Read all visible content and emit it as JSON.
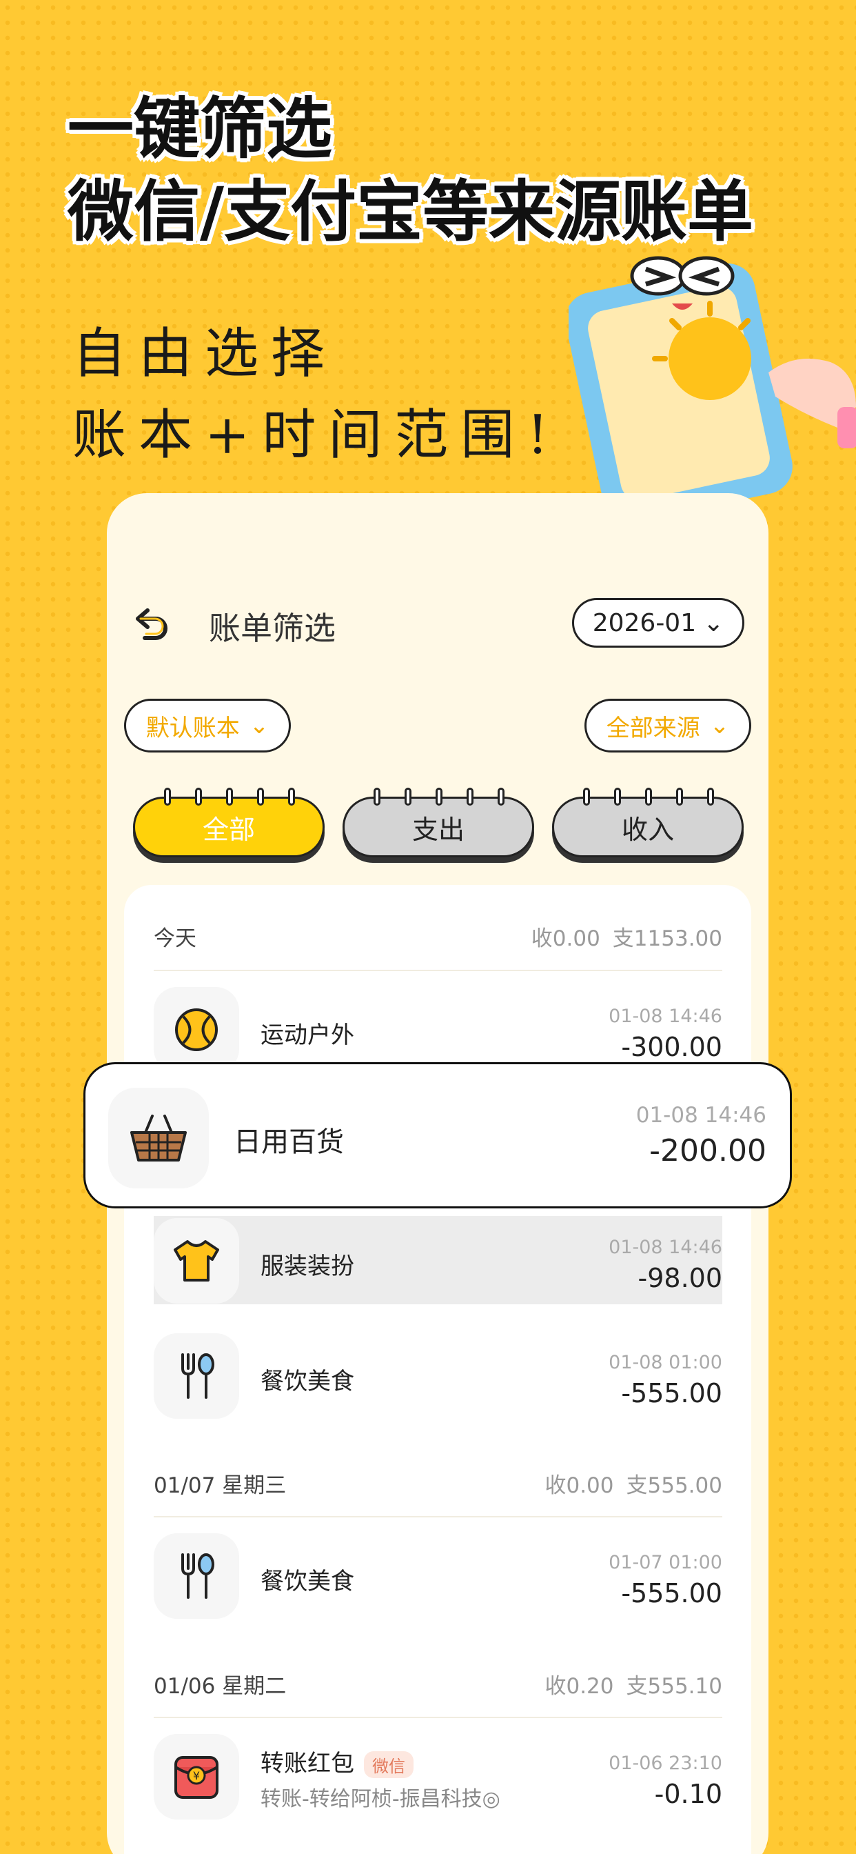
{
  "promo": {
    "headline_1": "一键筛选",
    "headline_2": "微信/支付宝等来源账单",
    "sub_1": "自由选择",
    "sub_2": "账本+时间范围!"
  },
  "header": {
    "title": "账单筛选",
    "date": "2026-01"
  },
  "filters": {
    "book": "默认账本",
    "source": "全部来源"
  },
  "tabs": {
    "all": "全部",
    "expense": "支出",
    "income": "收入"
  },
  "days": [
    {
      "label": "今天",
      "income": "收0.00",
      "expense": "支1153.00"
    },
    {
      "label": "01/07 星期三",
      "income": "收0.00",
      "expense": "支555.00"
    },
    {
      "label": "01/06 星期二",
      "income": "收0.20",
      "expense": "支555.10"
    }
  ],
  "rows": [
    {
      "name": "运动户外",
      "time": "01-08 14:46",
      "amount": "-300.00",
      "icon": "tennis-ball-icon"
    },
    {
      "name": "服装装扮",
      "time": "01-08 14:46",
      "amount": "-98.00",
      "icon": "tshirt-icon"
    },
    {
      "name": "餐饮美食",
      "time": "01-08 01:00",
      "amount": "-555.00",
      "icon": "fork-spoon-icon"
    },
    {
      "name": "餐饮美食",
      "time": "01-07 01:00",
      "amount": "-555.00",
      "icon": "fork-spoon-icon"
    },
    {
      "name": "转账红包",
      "tag": "微信",
      "memo": "转账-转给阿桢-振昌科技◎",
      "time": "01-06 23:10",
      "amount": "-0.10",
      "icon": "red-envelope-icon"
    }
  ],
  "popout": {
    "name": "日用百货",
    "time": "01-08 14:46",
    "amount": "-200.00",
    "icon": "basket-icon"
  },
  "colors": {
    "accent": "#ffd20a",
    "background": "#ffc933",
    "card": "#fff9e6"
  }
}
